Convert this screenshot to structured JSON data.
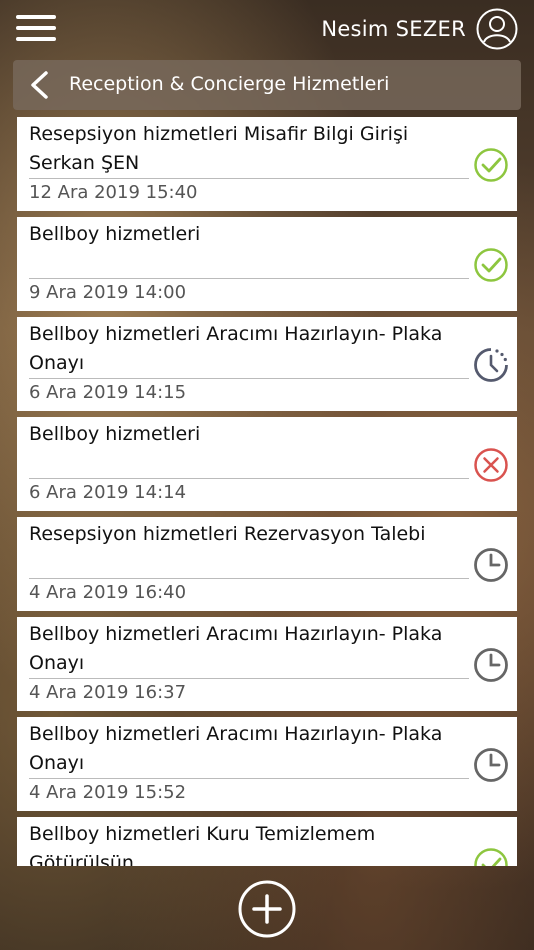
{
  "user": {
    "name": "Nesim SEZER"
  },
  "header": {
    "title": "Reception & Concierge Hizmetleri"
  },
  "requests": [
    {
      "title": "Resepsiyon hizmetleri Misafir Bilgi Girişi Serkan ŞEN",
      "date": "12 Ara 2019 15:40",
      "status": "completed"
    },
    {
      "title": "Bellboy hizmetleri",
      "date": "9 Ara 2019 14:00",
      "status": "completed"
    },
    {
      "title": "Bellboy hizmetleri Aracımı Hazırlayın- Plaka Onayı",
      "date": "6 Ara 2019 14:15",
      "status": "in-progress"
    },
    {
      "title": "Bellboy hizmetleri",
      "date": "6 Ara 2019 14:14",
      "status": "cancelled"
    },
    {
      "title": "Resepsiyon hizmetleri Rezervasyon Talebi",
      "date": "4 Ara 2019 16:40",
      "status": "pending"
    },
    {
      "title": "Bellboy hizmetleri Aracımı Hazırlayın- Plaka Onayı",
      "date": "4 Ara 2019 16:37",
      "status": "pending"
    },
    {
      "title": "Bellboy hizmetleri Aracımı Hazırlayın- Plaka Onayı",
      "date": "4 Ara 2019 15:52",
      "status": "pending"
    },
    {
      "title": "Bellboy hizmetleri Kuru Temizlemem Götürülsün",
      "date": "",
      "status": "completed"
    }
  ],
  "colors": {
    "completed": "#8dc63f",
    "pending": "#666666",
    "in-progress": "#555a6e",
    "cancelled": "#d9534f"
  },
  "icons": {
    "menu": "hamburger-menu-icon",
    "avatar": "user-circle-icon",
    "back": "chevron-left-icon",
    "add": "plus-circle-icon"
  }
}
